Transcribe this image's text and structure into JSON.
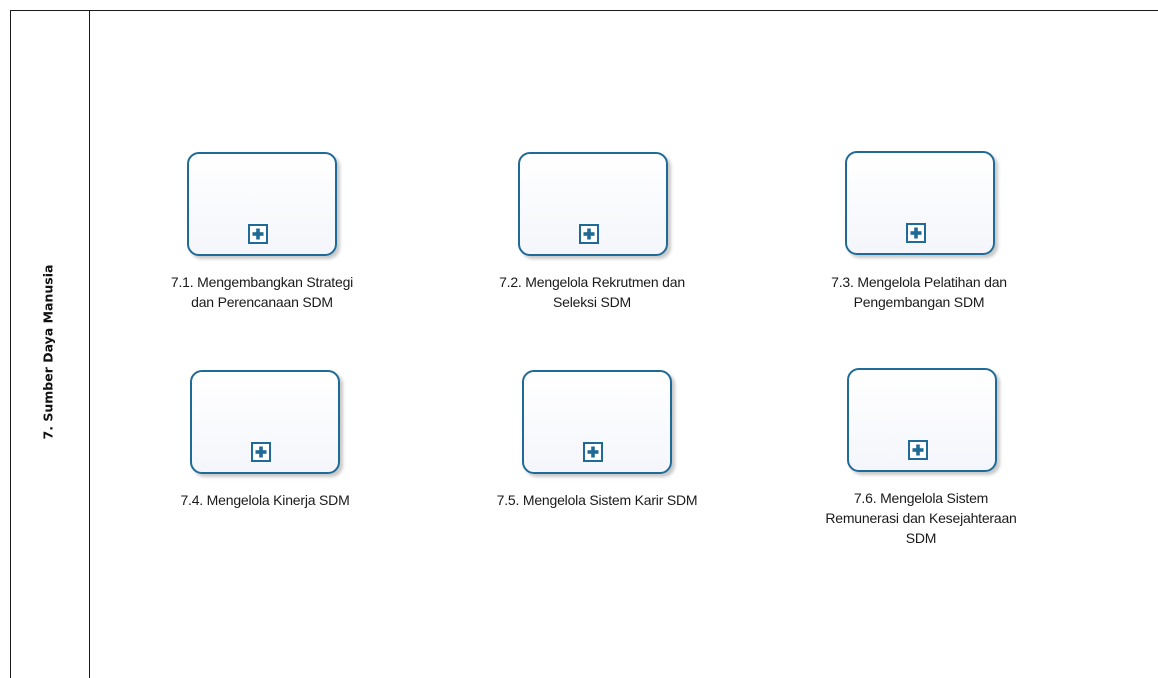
{
  "lane": {
    "title": "7. Sumber Daya Manusia"
  },
  "tasks": [
    {
      "line1": "7.1. Mengembangkan Strategi",
      "line2": "dan Perencanaan SDM",
      "line3": ""
    },
    {
      "line1": "7.2. Mengelola Rekrutmen dan",
      "line2": "Seleksi SDM",
      "line3": ""
    },
    {
      "line1": "7.3. Mengelola Pelatihan dan",
      "line2": "Pengembangan SDM",
      "line3": ""
    },
    {
      "line1": "7.4. Mengelola Kinerja SDM",
      "line2": "",
      "line3": ""
    },
    {
      "line1": "7.5. Mengelola Sistem Karir SDM",
      "line2": "",
      "line3": ""
    },
    {
      "line1": "7.6. Mengelola Sistem",
      "line2": "Remunerasi dan Kesejahteraan",
      "line3": "SDM"
    }
  ],
  "colors": {
    "task_border": "#1f6a96",
    "marker_plus": "#1f6a96",
    "lines": "#1a1a1a"
  },
  "icons": {
    "subprocess_marker": "plus-in-square-icon"
  }
}
